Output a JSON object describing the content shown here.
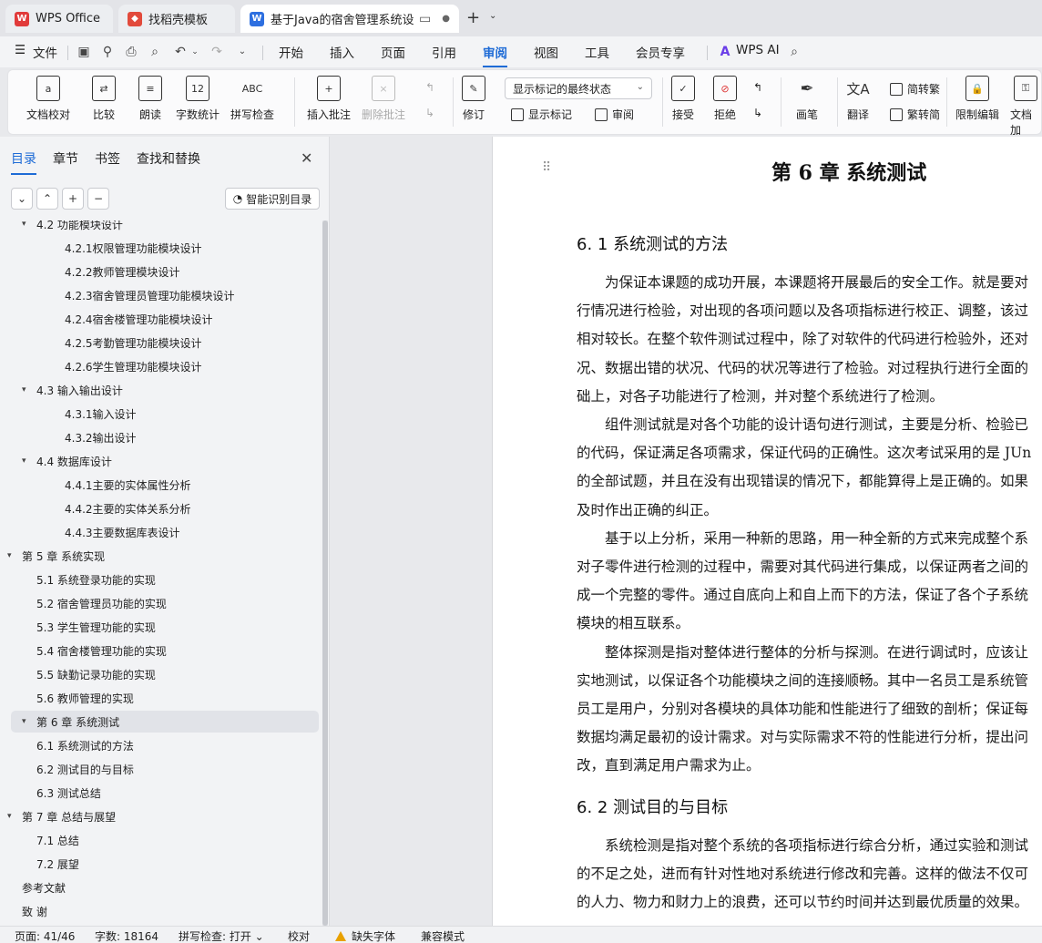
{
  "tabs": [
    {
      "label": "WPS Office",
      "icon": "wps-logo-icon"
    },
    {
      "label": "找稻壳模板",
      "icon": "docer-icon"
    },
    {
      "label": "基于Java的宿舍管理系统设计与",
      "icon": "word-doc-icon"
    }
  ],
  "menu": {
    "file": "文件",
    "items": [
      "开始",
      "插入",
      "页面",
      "引用",
      "审阅",
      "视图",
      "工具",
      "会员专享"
    ],
    "active": "审阅",
    "ai": "WPS AI"
  },
  "ribbon": {
    "doc_check": "文档校对",
    "compare": "比较",
    "read_aloud": "朗读",
    "word_count": "字数统计",
    "spell_check": "拼写检查",
    "insert_comment": "插入批注",
    "delete_comment": "删除批注",
    "revise": "修订",
    "markup_select": "显示标记的最终状态",
    "show_markup": "显示标记",
    "review": "审阅",
    "accept": "接受",
    "reject": "拒绝",
    "pen": "画笔",
    "translate": "翻译",
    "to_traditional": "简转繁",
    "to_simplified": "繁转简",
    "restrict_edit": "限制编辑",
    "doc_encrypt": "文档加"
  },
  "sidebar": {
    "tabs": [
      "目录",
      "章节",
      "书签",
      "查找和替换"
    ],
    "ai_toc": "智能识别目录",
    "toc": [
      {
        "text": "4.2 功能模块设计",
        "level": 2,
        "caret": "▾"
      },
      {
        "text": "4.2.1权限管理功能模块设计",
        "level": 3
      },
      {
        "text": "4.2.2教师管理模块设计",
        "level": 3
      },
      {
        "text": "4.2.3宿舍管理员管理功能模块设计",
        "level": 3
      },
      {
        "text": "4.2.4宿舍楼管理功能模块设计",
        "level": 3
      },
      {
        "text": "4.2.5考勤管理功能模块设计",
        "level": 3
      },
      {
        "text": "4.2.6学生管理功能模块设计",
        "level": 3
      },
      {
        "text": "4.3 输入输出设计",
        "level": 2,
        "caret": "▾"
      },
      {
        "text": "4.3.1输入设计",
        "level": 3
      },
      {
        "text": "4.3.2输出设计",
        "level": 3
      },
      {
        "text": "4.4 数据库设计",
        "level": 2,
        "caret": "▾"
      },
      {
        "text": "4.4.1主要的实体属性分析",
        "level": 3
      },
      {
        "text": "4.4.2主要的实体关系分析",
        "level": 3
      },
      {
        "text": "4.4.3主要数据库表设计",
        "level": 3
      },
      {
        "text": "第 5 章  系统实现",
        "level": 1,
        "caret": "▾"
      },
      {
        "text": "5.1 系统登录功能的实现",
        "level": 2
      },
      {
        "text": "5.2 宿舍管理员功能的实现",
        "level": 2
      },
      {
        "text": "5.3 学生管理功能的实现",
        "level": 2
      },
      {
        "text": "5.4 宿舍楼管理功能的实现",
        "level": 2
      },
      {
        "text": "5.5 缺勤记录功能的实现",
        "level": 2
      },
      {
        "text": "5.6 教师管理的实现",
        "level": 2
      },
      {
        "text": "第 6 章  系统测试",
        "level": 1,
        "caret": "▾",
        "selected": true
      },
      {
        "text": "6.1 系统测试的方法",
        "level": 2
      },
      {
        "text": "6.2 测试目的与目标",
        "level": 2
      },
      {
        "text": "6.3 测试总结",
        "level": 2
      },
      {
        "text": "第 7 章  总结与展望",
        "level": 1,
        "caret": "▾"
      },
      {
        "text": "7.1 总结",
        "level": 2
      },
      {
        "text": "7.2 展望",
        "level": 2
      },
      {
        "text": "参考文献",
        "level": 1
      },
      {
        "text": "致  谢",
        "level": 1
      }
    ]
  },
  "document": {
    "chapter_title": "第 6 章  系统测试",
    "sections": [
      {
        "title": "6. 1 系统测试的方法",
        "lines": [
          "　　为保证本课题的成功开展，本课题将开展最后的安全工作。就是要对",
          "行情况进行检验，对出现的各项问题以及各项指标进行校正、调整，该过",
          "相对较长。在整个软件测试过程中，除了对软件的代码进行检验外，还对",
          "况、数据出错的状况、代码的状况等进行了检验。对过程执行进行全面的",
          "础上，对各子功能进行了检测，并对整个系统进行了检测。",
          "　　组件测试就是对各个功能的设计语句进行测试，主要是分析、检验已",
          "的代码，保证满足各项需求，保证代码的正确性。这次考试采用的是 JUn",
          "的全部试题，并且在没有出现错误的情况下，都能算得上是正确的。如果",
          "及时作出正确的纠正。",
          "　　基于以上分析，采用一种新的思路，用一种全新的方式来完成整个系",
          "对子零件进行检测的过程中，需要对其代码进行集成，以保证两者之间的",
          "成一个完整的零件。通过自底向上和自上而下的方法，保证了各个子系统",
          "模块的相互联系。",
          "　　整体探测是指对整体进行整体的分析与探测。在进行调试时，应该让",
          "实地测试，以保证各个功能模块之间的连接顺畅。其中一名员工是系统管",
          "员工是用户，分别对各模块的具体功能和性能进行了细致的剖析；保证每",
          "数据均满足最初的设计需求。对与实际需求不符的性能进行分析，提出问",
          "改，直到满足用户需求为止。"
        ]
      },
      {
        "title": "6. 2 测试目的与目标",
        "lines": [
          "　　系统检测是指对整个系统的各项指标进行综合分析，通过实验和测试",
          "的不足之处，进而有针对性地对系统进行修改和完善。这样的做法不仅可",
          "的人力、物力和财力上的浪费，还可以节约时间并达到最优质量的效果。"
        ]
      }
    ]
  },
  "status": {
    "page": "页面: 41/46",
    "words": "字数: 18164",
    "spell": "拼写检查: 打开 ⌄",
    "proof": "校对",
    "missing_font": "缺失字体",
    "compat": "兼容模式"
  }
}
